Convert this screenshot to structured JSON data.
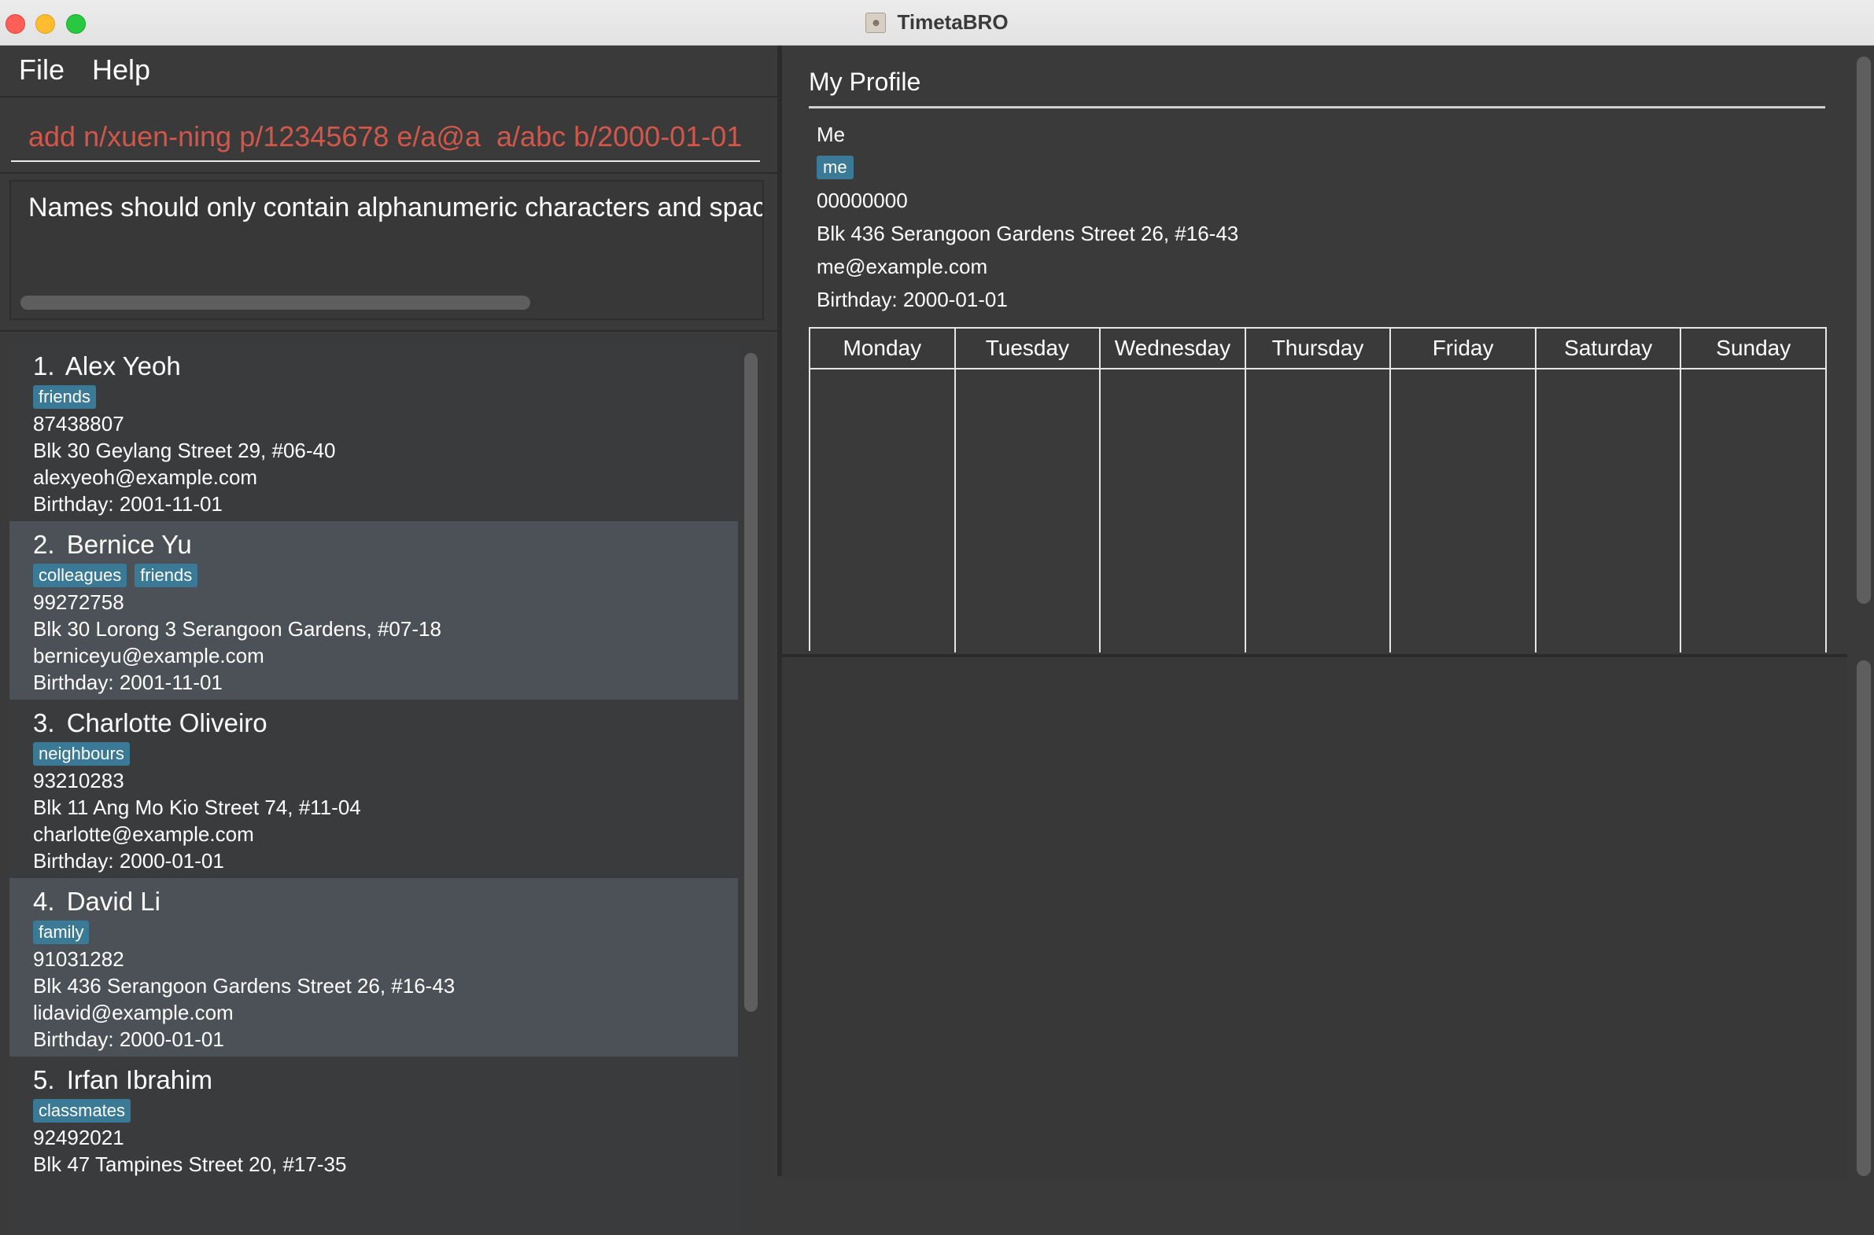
{
  "window": {
    "title": "TimetaBRO"
  },
  "menu": {
    "file": "File",
    "help": "Help"
  },
  "command": {
    "value": "add n/xuen-ning p/12345678 e/a@a  a/abc b/2000-01-01"
  },
  "result": {
    "message": "Names should only contain alphanumeric characters and spaces"
  },
  "persons": [
    {
      "index": "1.",
      "name": "Alex Yeoh",
      "tags": [
        "friends"
      ],
      "phone": "87438807",
      "address": "Blk 30 Geylang Street 29, #06-40",
      "email": "alexyeoh@example.com",
      "birthday": "Birthday: 2001-11-01"
    },
    {
      "index": "2.",
      "name": "Bernice Yu",
      "tags": [
        "colleagues",
        "friends"
      ],
      "phone": "99272758",
      "address": "Blk 30 Lorong 3 Serangoon Gardens, #07-18",
      "email": "berniceyu@example.com",
      "birthday": "Birthday: 2001-11-01"
    },
    {
      "index": "3.",
      "name": "Charlotte Oliveiro",
      "tags": [
        "neighbours"
      ],
      "phone": "93210283",
      "address": "Blk 11 Ang Mo Kio Street 74, #11-04",
      "email": "charlotte@example.com",
      "birthday": "Birthday: 2000-01-01"
    },
    {
      "index": "4.",
      "name": "David Li",
      "tags": [
        "family"
      ],
      "phone": "91031282",
      "address": "Blk 436 Serangoon Gardens Street 26, #16-43",
      "email": "lidavid@example.com",
      "birthday": "Birthday: 2000-01-01"
    },
    {
      "index": "5.",
      "name": "Irfan Ibrahim",
      "tags": [
        "classmates"
      ],
      "phone": "92492021",
      "address": "Blk 47 Tampines Street 20, #17-35",
      "email": "",
      "birthday": ""
    }
  ],
  "profile": {
    "heading": "My Profile",
    "name": "Me",
    "tag": "me",
    "phone": "00000000",
    "address": "Blk 436 Serangoon Gardens Street 26, #16-43",
    "email": "me@example.com",
    "birthday": "Birthday: 2000-01-01"
  },
  "timetable": {
    "days": [
      "Monday",
      "Tuesday",
      "Wednesday",
      "Thursday",
      "Friday",
      "Saturday",
      "Sunday"
    ]
  },
  "colors": {
    "tag": "#3b7a96",
    "command_text": "#d2574a",
    "background": "#3a3a3a"
  }
}
